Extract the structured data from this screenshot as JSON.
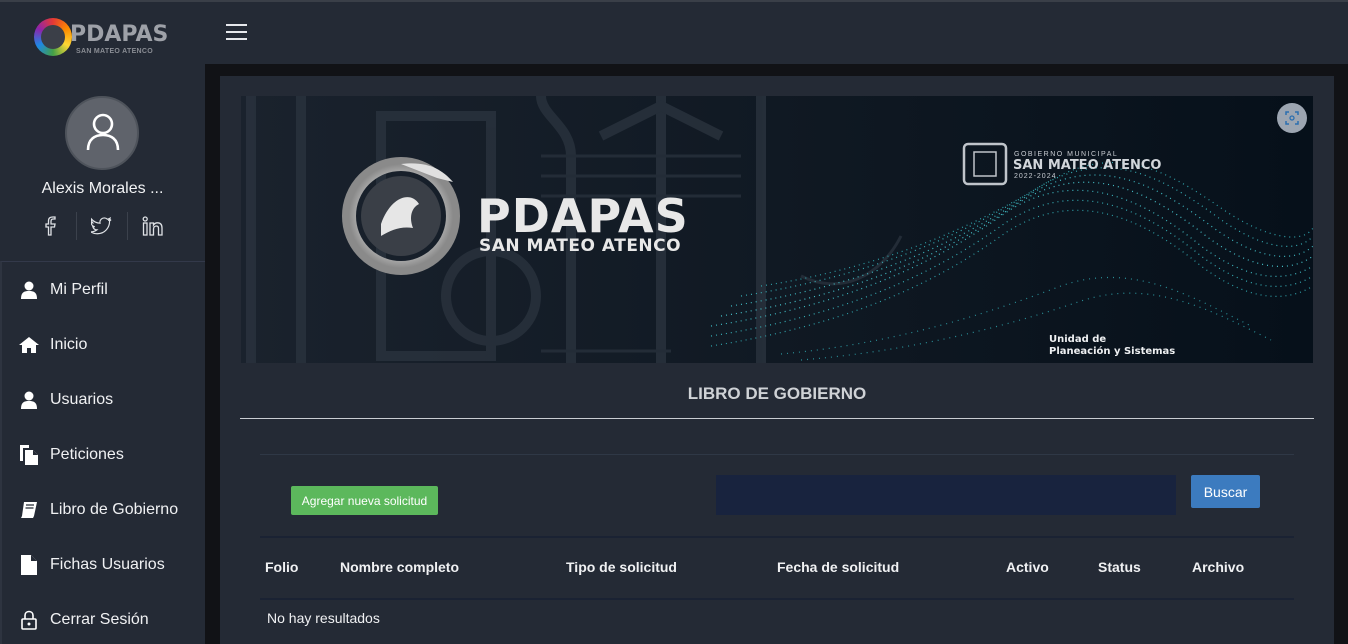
{
  "brand": {
    "name": "PDAPAS",
    "subtitle": "SAN MATEO ATENCO"
  },
  "user": {
    "name": "Alexis Morales ..."
  },
  "social": [
    {
      "icon": "facebook-icon",
      "glyph": "f"
    },
    {
      "icon": "twitter-icon",
      "glyph": "twitter"
    },
    {
      "icon": "linkedin-icon",
      "glyph": "in"
    }
  ],
  "nav": [
    {
      "label": "Mi Perfil",
      "icon": "user-icon"
    },
    {
      "label": "Inicio",
      "icon": "home-icon"
    },
    {
      "label": "Usuarios",
      "icon": "user-icon"
    },
    {
      "label": "Peticiones",
      "icon": "documents-icon"
    },
    {
      "label": "Libro de Gobierno",
      "icon": "book-icon"
    },
    {
      "label": "Fichas Usuarios",
      "icon": "file-icon"
    },
    {
      "label": "Cerrar Sesión",
      "icon": "lock-icon"
    }
  ],
  "banner": {
    "brand": "PDAPAS",
    "brand_sub": "SAN MATEO ATENCO",
    "gov_line1": "GOBIERNO MUNICIPAL",
    "gov_line2": "SAN MATEO ATENCO",
    "gov_years": "2022-2024",
    "unit_line1": "Unidad de",
    "unit_line2": "Planeación y Sistemas"
  },
  "page": {
    "title": "LIBRO DE GOBIERNO"
  },
  "toolbar": {
    "add_label": "Agregar nueva solicitud",
    "search_placeholder": "",
    "search_value": "",
    "search_label": "Buscar"
  },
  "table": {
    "columns": [
      "Folio",
      "Nombre completo",
      "Tipo de solicitud",
      "Fecha de solicitud",
      "Activo",
      "Status",
      "Archivo"
    ],
    "rows": [],
    "empty_message": "No hay resultados"
  },
  "colors": {
    "accent_green": "#5cb85c",
    "accent_blue": "#3c7bbf",
    "panel": "#242a35",
    "background": "#111216"
  }
}
